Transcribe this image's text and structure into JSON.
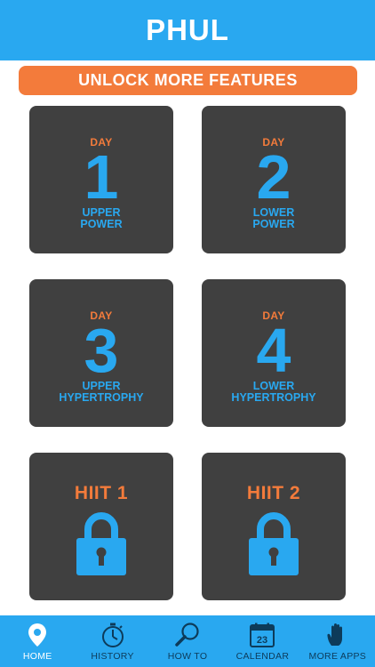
{
  "header": {
    "title": "PHUL"
  },
  "banner": {
    "label": "UNLOCK MORE FEATURES"
  },
  "tiles": [
    {
      "day": "DAY",
      "number": "1",
      "line1": "UPPER",
      "line2": "POWER"
    },
    {
      "day": "DAY",
      "number": "2",
      "line1": "LOWER",
      "line2": "POWER"
    },
    {
      "day": "DAY",
      "number": "3",
      "line1": "UPPER",
      "line2": "HYPERTROPHY"
    },
    {
      "day": "DAY",
      "number": "4",
      "line1": "LOWER",
      "line2": "HYPERTROPHY"
    }
  ],
  "hiit": [
    {
      "title": "HIIT 1",
      "icon": "lock-icon"
    },
    {
      "title": "HIIT 2",
      "icon": "lock-icon"
    }
  ],
  "tabs": [
    {
      "label": "HOME",
      "icon": "map-pin-icon",
      "active": true
    },
    {
      "label": "HISTORY",
      "icon": "stopwatch-icon"
    },
    {
      "label": "HOW TO",
      "icon": "magnifier-icon"
    },
    {
      "label": "CALENDAR",
      "icon": "calendar-icon",
      "calendar_day": "23"
    },
    {
      "label": "MORE APPS",
      "icon": "hand-icon"
    }
  ],
  "colors": {
    "brand_blue": "#29a8f0",
    "accent_orange": "#f37b3b",
    "tile_gray": "#404040"
  }
}
